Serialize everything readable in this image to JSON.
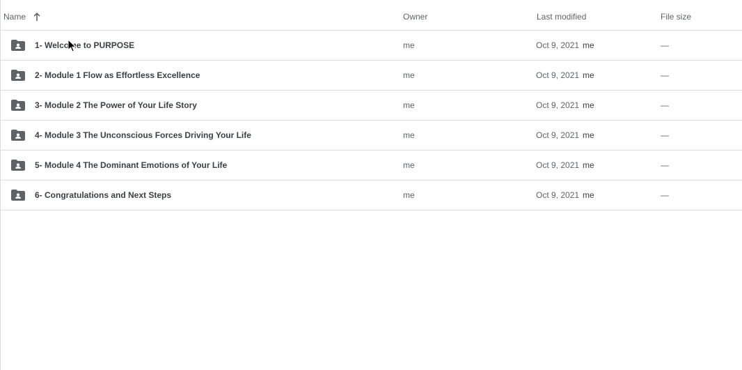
{
  "header": {
    "name_label": "Name",
    "owner_label": "Owner",
    "modified_label": "Last modified",
    "size_label": "File size",
    "sort_icon": "arrow-up-icon"
  },
  "rows": [
    {
      "name": "1- Welcome to PURPOSE",
      "owner": "me",
      "modified": "Oct 9, 2021",
      "modified_by": "me",
      "size": "—",
      "icon": "shared-folder-icon"
    },
    {
      "name": "2- Module 1 Flow as Effortless Excellence",
      "owner": "me",
      "modified": "Oct 9, 2021",
      "modified_by": "me",
      "size": "—",
      "icon": "shared-folder-icon"
    },
    {
      "name": "3- Module 2 The Power of Your Life Story",
      "owner": "me",
      "modified": "Oct 9, 2021",
      "modified_by": "me",
      "size": "—",
      "icon": "shared-folder-icon"
    },
    {
      "name": "4- Module 3 The Unconscious Forces Driving Your Life",
      "owner": "me",
      "modified": "Oct 9, 2021",
      "modified_by": "me",
      "size": "—",
      "icon": "shared-folder-icon"
    },
    {
      "name": "5- Module 4 The Dominant Emotions of Your Life",
      "owner": "me",
      "modified": "Oct 9, 2021",
      "modified_by": "me",
      "size": "—",
      "icon": "shared-folder-icon"
    },
    {
      "name": "6- Congratulations and Next Steps",
      "owner": "me",
      "modified": "Oct 9, 2021",
      "modified_by": "me",
      "size": "—",
      "icon": "shared-folder-icon"
    }
  ],
  "colors": {
    "divider": "#dadce0",
    "text_primary": "#3c4043",
    "text_secondary": "#5f6368",
    "icon": "#5f6368"
  }
}
